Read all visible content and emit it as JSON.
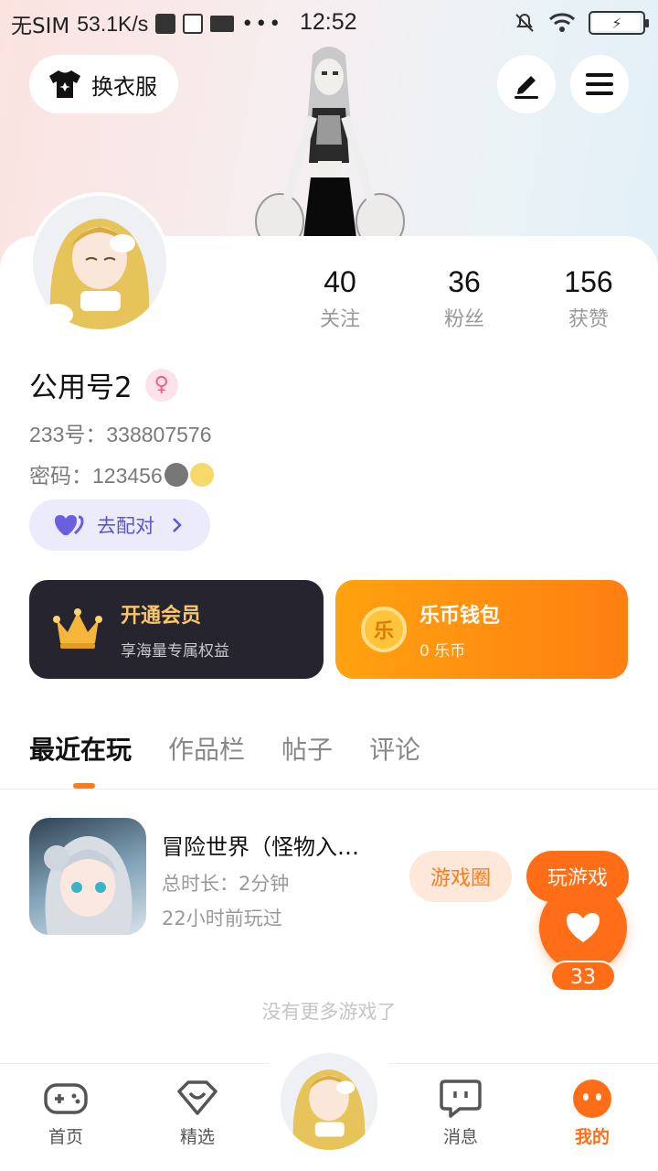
{
  "status_bar": {
    "carrier": "无SIM",
    "speed": "53.1K/s",
    "time": "12:52",
    "dots": "•••"
  },
  "header": {
    "dress_button_label": "换衣服"
  },
  "profile": {
    "stats": [
      {
        "value": "40",
        "label": "关注"
      },
      {
        "value": "36",
        "label": "粉丝"
      },
      {
        "value": "156",
        "label": "获赞"
      }
    ],
    "username": "公用号2",
    "gender_symbol": "♀",
    "id_line": "233号：338807576",
    "password_line": "密码：123456"
  },
  "match_button": {
    "label": "去配对"
  },
  "vip_card": {
    "title": "开通会员",
    "subtitle": "享海量专属权益"
  },
  "wallet_card": {
    "title": "乐币钱包",
    "subtitle": "0 乐币",
    "coin_char": "乐"
  },
  "tabs": [
    {
      "label": "最近在玩",
      "active": true
    },
    {
      "label": "作品栏",
      "active": false
    },
    {
      "label": "帖子",
      "active": false
    },
    {
      "label": "评论",
      "active": false
    }
  ],
  "recent_game": {
    "title": "冒险世界（怪物入…",
    "duration": "总时长：2分钟",
    "last_played": "22小时前玩过",
    "circle_button": "游戏圈",
    "play_button": "玩游戏"
  },
  "like_fab": {
    "count": "33"
  },
  "no_more_text": "没有更多游戏了",
  "bottom_nav": [
    {
      "label": "首页",
      "icon": "gamepad-icon"
    },
    {
      "label": "精选",
      "icon": "heart-gem-icon"
    },
    {
      "label": "消息",
      "icon": "chat-bubble-icon"
    },
    {
      "label": "我的",
      "icon": "profile-face-icon"
    }
  ],
  "colors": {
    "accent": "#ff7a1a",
    "vip_bg": "#26252f",
    "vip_text": "#f7c66a",
    "match_bg": "#ecebfb",
    "match_text": "#5b55d0"
  }
}
